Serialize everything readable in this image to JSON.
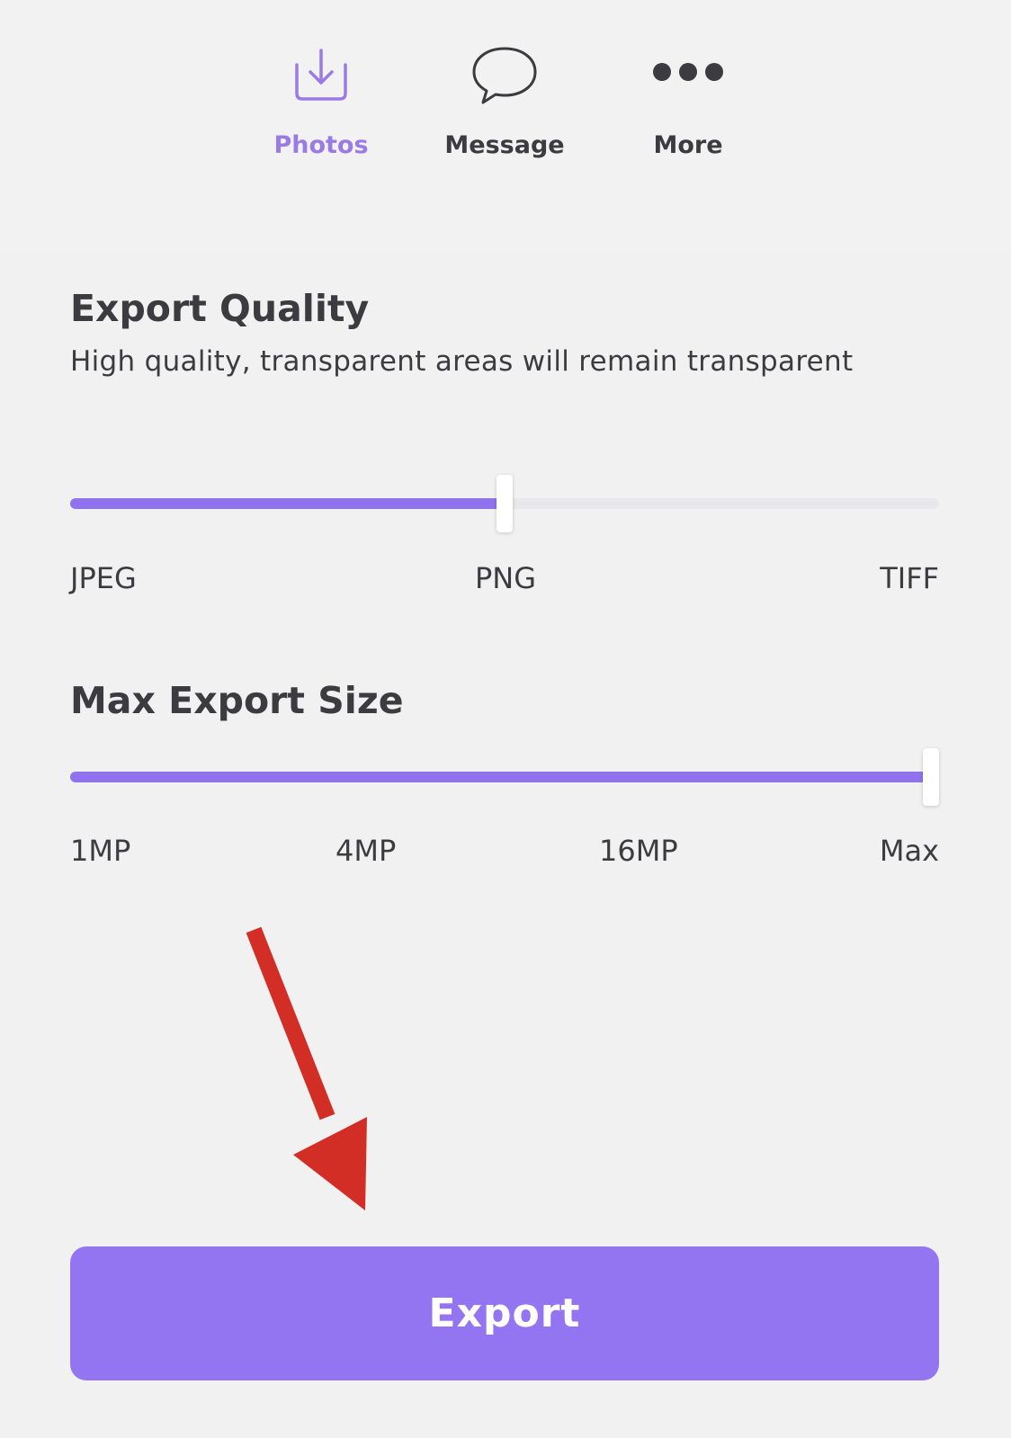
{
  "share": {
    "items": [
      {
        "label": "Photos",
        "icon": "download-to-photos-icon",
        "active": true
      },
      {
        "label": "Message",
        "icon": "speech-bubble-icon",
        "active": false
      },
      {
        "label": "More",
        "icon": "more-dots-icon",
        "active": false
      }
    ]
  },
  "export_quality": {
    "title": "Export Quality",
    "description": "High quality, transparent areas will remain transparent",
    "options": [
      "JPEG",
      "PNG",
      "TIFF"
    ],
    "selected": "PNG",
    "value_fraction": 0.5
  },
  "max_export_size": {
    "title": "Max Export Size",
    "options": [
      "1MP",
      "4MP",
      "16MP",
      "Max"
    ],
    "selected": "Max",
    "value_fraction": 1.0
  },
  "annotation": {
    "icon": "red-arrow-pointing-down",
    "color": "#d22e26"
  },
  "export_button": {
    "label": "Export"
  },
  "colors": {
    "accent": "#9374f1",
    "active_icon": "#9a7be6",
    "text": "#3c3c40",
    "background": "#f2f1f2"
  }
}
